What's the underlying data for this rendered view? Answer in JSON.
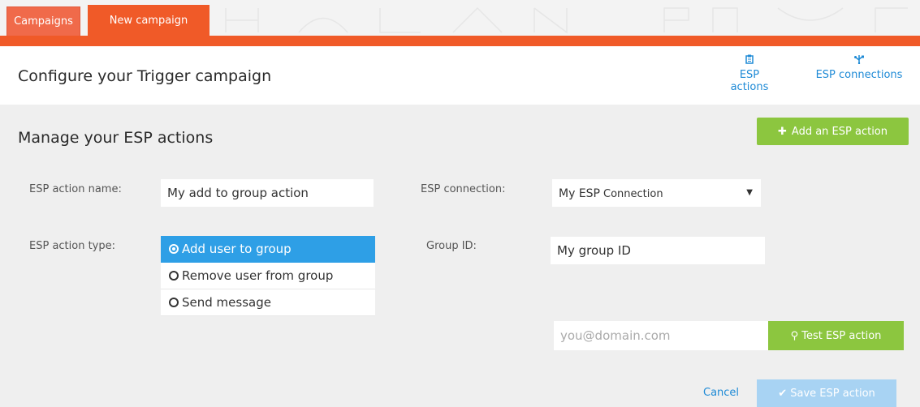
{
  "tabs": {
    "campaigns": "Campaigns",
    "new_campaign": "New campaign"
  },
  "header": {
    "title": "Configure your Trigger campaign",
    "esp_actions": "ESP actions",
    "esp_connections": "ESP connections"
  },
  "section": {
    "title": "Manage your ESP actions",
    "add_button": "Add an ESP action"
  },
  "form": {
    "action_name_label": "ESP action name:",
    "action_name_value": "My add to group action",
    "connection_label": "ESP connection:",
    "connection_main": "My ESP",
    "connection_sub": "Connection",
    "action_type_label": "ESP action type:",
    "action_types": [
      "Add user to group",
      "Remove user from group",
      "Send message"
    ],
    "group_id_label": "Group ID:",
    "group_id_value": "My group ID",
    "email_placeholder": "you@domain.com",
    "test_button": "Test ESP action",
    "cancel": "Cancel",
    "save_button": "Save ESP action"
  },
  "colors": {
    "brand_orange": "#f05a28",
    "accent_green": "#8cc63f",
    "link_blue": "#1e8ad6",
    "selected_blue": "#2e9fe6"
  },
  "icons": {
    "esp_actions": "clipboard-icon",
    "esp_connections": "usb-icon",
    "add": "plus-icon",
    "test": "flask-icon",
    "save": "check-icon"
  }
}
